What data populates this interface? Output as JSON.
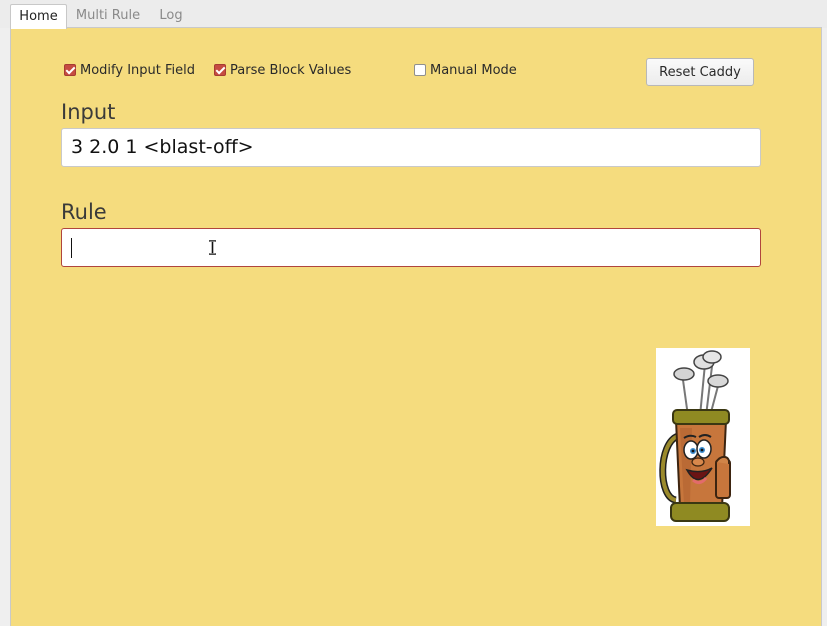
{
  "tabs": [
    {
      "label": "Home",
      "active": true
    },
    {
      "label": "Multi Rule",
      "active": false
    },
    {
      "label": "Log",
      "active": false
    }
  ],
  "options": {
    "modify_input_field": {
      "label": "Modify Input Field",
      "checked": true
    },
    "parse_block_values": {
      "label": "Parse Block Values",
      "checked": true
    },
    "manual_mode": {
      "label": "Manual Mode",
      "checked": false
    }
  },
  "reset_button": {
    "label": "Reset Caddy"
  },
  "input": {
    "label": "Input",
    "value": "3 2.0 1 <blast-off>"
  },
  "rule": {
    "label": "Rule",
    "value": ""
  },
  "mascot": {
    "icon": "golf-bag-mascot"
  },
  "colors": {
    "panel_background": "#f5dc7e",
    "checkbox_accent": "#c64b41",
    "focus_border": "#b0453d"
  }
}
